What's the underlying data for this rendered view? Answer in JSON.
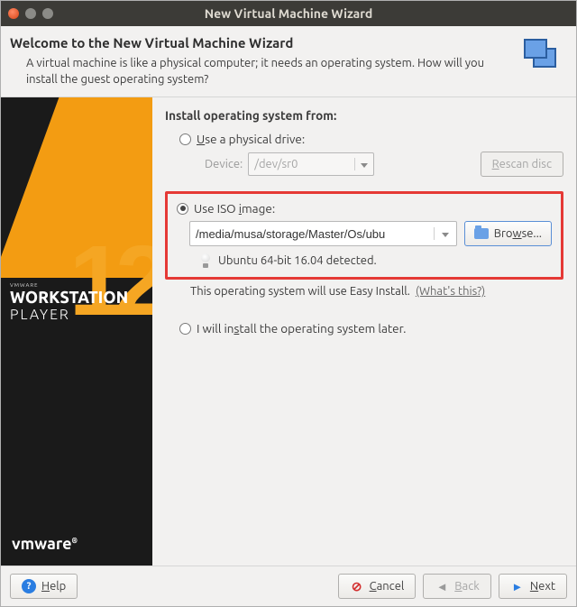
{
  "window": {
    "title": "New Virtual Machine Wizard"
  },
  "header": {
    "title": "Welcome to the New Virtual Machine Wizard",
    "subtitle": "A virtual machine is like a physical computer; it needs an operating system. How will you install the guest operating system?"
  },
  "sidebar": {
    "product_small": "VMWARE",
    "product_line1": "WORKSTATION",
    "product_line2": "PLAYER",
    "version_glyph": "12",
    "brand": "vmware"
  },
  "main": {
    "section_title": "Install operating system from:",
    "option_physical": {
      "label_pre": "U",
      "label_rest": "se a physical drive:",
      "device_label": "Device:",
      "device_value": "/dev/sr0",
      "rescan_pre": "R",
      "rescan_rest": "escan disc"
    },
    "option_iso": {
      "label_pre": "Use ISO ",
      "accel": "i",
      "label_rest": "mage:",
      "path": "/media/musa/storage/Master/Os/ubu",
      "browse_pre": "Bro",
      "browse_accel": "w",
      "browse_rest": "se...",
      "detected": "Ubuntu 64-bit 16.04 detected."
    },
    "easy_install_text": "This operating system will use Easy Install.",
    "whats_this": "(What's this?)",
    "option_later": {
      "pre": "I will in",
      "accel": "s",
      "rest": "tall the operating system later."
    }
  },
  "footer": {
    "help_pre": "H",
    "help_rest": "elp",
    "cancel_pre": "C",
    "cancel_rest": "ancel",
    "back_pre": "B",
    "back_rest": "ack",
    "next_pre": "N",
    "next_rest": "ext"
  }
}
